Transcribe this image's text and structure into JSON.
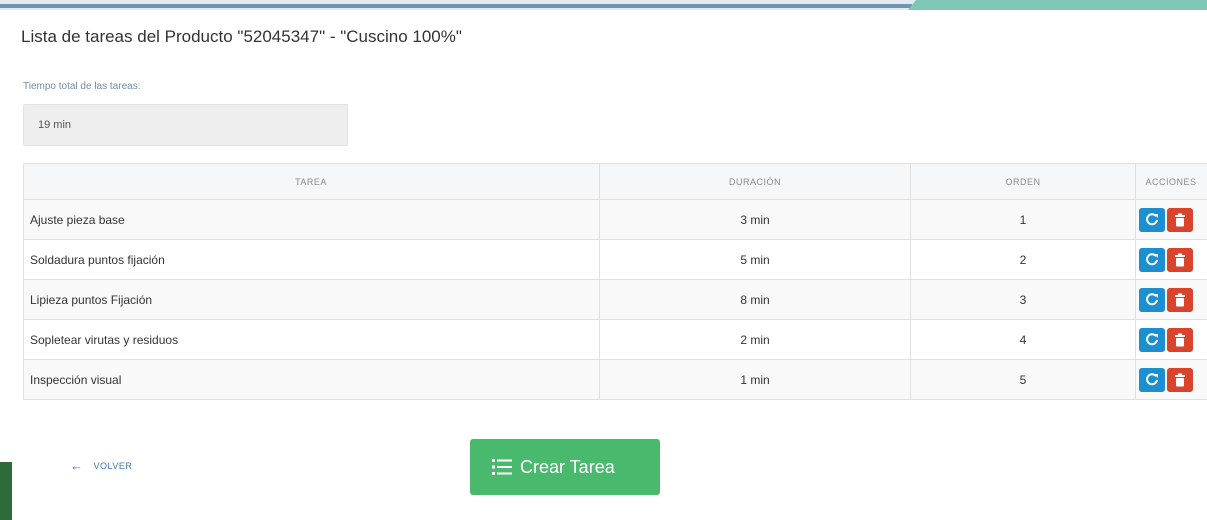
{
  "panel": {
    "title": "Lista de tareas del Producto \"52045347\" - \"Cuscino 100%\"",
    "total_label": "Tiempo total de las tareas:",
    "total_value": "19 min"
  },
  "table": {
    "headers": {
      "task": "TAREA",
      "duration": "DURACIÓN",
      "order": "ORDEN",
      "actions": "ACCIONES"
    },
    "rows": [
      {
        "task": "Ajuste pieza base",
        "duration": "3 min",
        "order": "1"
      },
      {
        "task": "Soldadura puntos fijación",
        "duration": "5 min",
        "order": "2"
      },
      {
        "task": "Lipieza puntos Fijación",
        "duration": "8 min",
        "order": "3"
      },
      {
        "task": "Sopletear virutas y residuos",
        "duration": "2 min",
        "order": "4"
      },
      {
        "task": "Inspección visual",
        "duration": "1 min",
        "order": "5"
      }
    ],
    "action_icons": {
      "edit": "edit-icon",
      "delete": "trash-icon"
    }
  },
  "footer": {
    "back_label": "VOLVER",
    "back_icon": "arrow-left-icon",
    "create_label": "Crear Tarea",
    "create_icon": "list-icon"
  },
  "colors": {
    "edit_button": "#1c8fd0",
    "delete_button": "#d9452c",
    "create_button": "#49b96e",
    "link": "#3a78b8"
  }
}
